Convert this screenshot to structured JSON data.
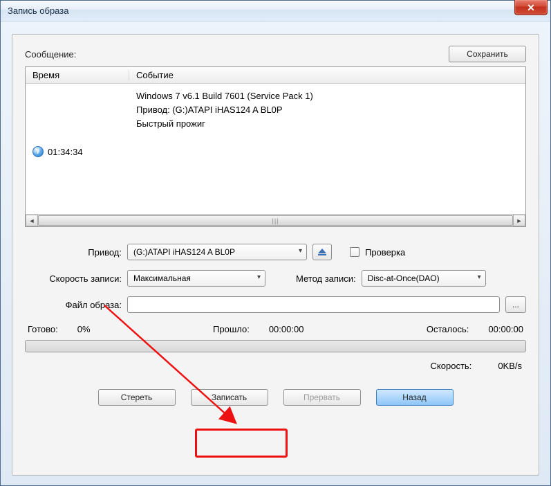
{
  "window": {
    "title": "Запись образа"
  },
  "buttons": {
    "save": "Сохранить",
    "erase": "Стереть",
    "write": "Записать",
    "abort": "Прервать",
    "back": "Назад",
    "browse": "..."
  },
  "labels": {
    "message": "Сообщение:",
    "time_col": "Время",
    "event_col": "Событие",
    "drive": "Привод:",
    "write_speed": "Скорость записи:",
    "write_method": "Метод записи:",
    "image_file": "Файл образа:",
    "verify": "Проверка",
    "ready": "Готово:",
    "elapsed": "Прошло:",
    "remaining": "Осталось:",
    "speed": "Скорость:"
  },
  "log": {
    "time": "01:34:34",
    "line1": "Windows 7 v6.1 Build 7601 (Service Pack 1)",
    "line2": "Привод: (G:)ATAPI   iHAS124   A     BL0P",
    "line3": "Быстрый прожиг"
  },
  "form": {
    "drive_value": "(G:)ATAPI   iHAS124   A     BL0P",
    "speed_value": "Максимальная",
    "method_value": "Disc-at-Once(DAO)",
    "image_path": ""
  },
  "status": {
    "ready_pct": "0%",
    "elapsed_time": "00:00:00",
    "remaining_time": "00:00:00",
    "speed_value": "0KB/s"
  }
}
